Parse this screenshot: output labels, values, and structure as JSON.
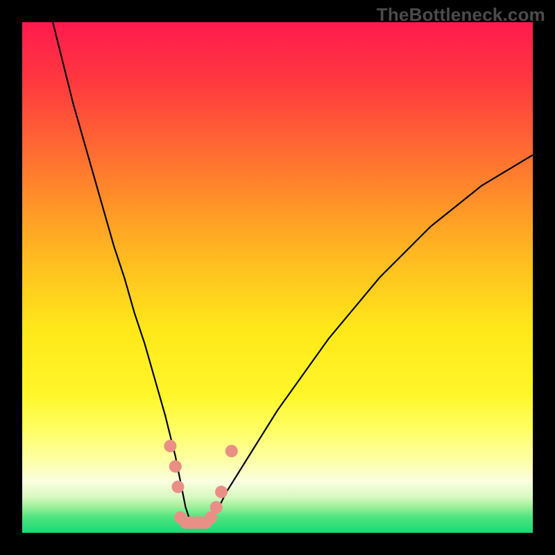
{
  "watermark": "TheBottleneck.com",
  "chart_data": {
    "type": "line",
    "title": "",
    "xlabel": "",
    "ylabel": "",
    "xlim": [
      0,
      100
    ],
    "ylim": [
      0,
      100
    ],
    "background_gradient": {
      "stops": [
        {
          "pct": 0,
          "color": "#ff1a4e"
        },
        {
          "pct": 12,
          "color": "#ff3a3e"
        },
        {
          "pct": 28,
          "color": "#ff762f"
        },
        {
          "pct": 45,
          "color": "#ffb721"
        },
        {
          "pct": 60,
          "color": "#ffe81a"
        },
        {
          "pct": 73,
          "color": "#fff62a"
        },
        {
          "pct": 80,
          "color": "#ffff66"
        },
        {
          "pct": 86,
          "color": "#fdffa8"
        },
        {
          "pct": 90,
          "color": "#fafee0"
        },
        {
          "pct": 93,
          "color": "#d7f9c0"
        },
        {
          "pct": 95,
          "color": "#9aef98"
        },
        {
          "pct": 97,
          "color": "#4ce47f"
        },
        {
          "pct": 100,
          "color": "#19da74"
        }
      ]
    },
    "series": [
      {
        "name": "bottleneck-curve",
        "color": "#000000",
        "x": [
          6,
          8,
          10,
          12,
          14,
          16,
          18,
          20,
          22,
          24,
          26,
          28,
          30,
          31,
          32,
          33,
          34,
          36,
          38,
          40,
          45,
          50,
          55,
          60,
          65,
          70,
          75,
          80,
          85,
          90,
          95,
          100
        ],
        "y": [
          100,
          92,
          84,
          77,
          70,
          63,
          56,
          50,
          43,
          37,
          30,
          23,
          15,
          10,
          5,
          2,
          2,
          2,
          4,
          8,
          16,
          24,
          31,
          38,
          44,
          50,
          55,
          60,
          64,
          68,
          71,
          74
        ]
      }
    ],
    "markers": {
      "name": "highlight-points",
      "color": "#ea8f86",
      "radius_px": 9,
      "points": [
        {
          "x": 29,
          "y": 17
        },
        {
          "x": 30,
          "y": 13
        },
        {
          "x": 30.5,
          "y": 9
        },
        {
          "x": 31,
          "y": 3
        },
        {
          "x": 32,
          "y": 2
        },
        {
          "x": 33,
          "y": 2
        },
        {
          "x": 34,
          "y": 2
        },
        {
          "x": 35,
          "y": 2
        },
        {
          "x": 36,
          "y": 2
        },
        {
          "x": 37,
          "y": 3
        },
        {
          "x": 38,
          "y": 5
        },
        {
          "x": 39,
          "y": 8
        },
        {
          "x": 41,
          "y": 16
        }
      ]
    }
  }
}
